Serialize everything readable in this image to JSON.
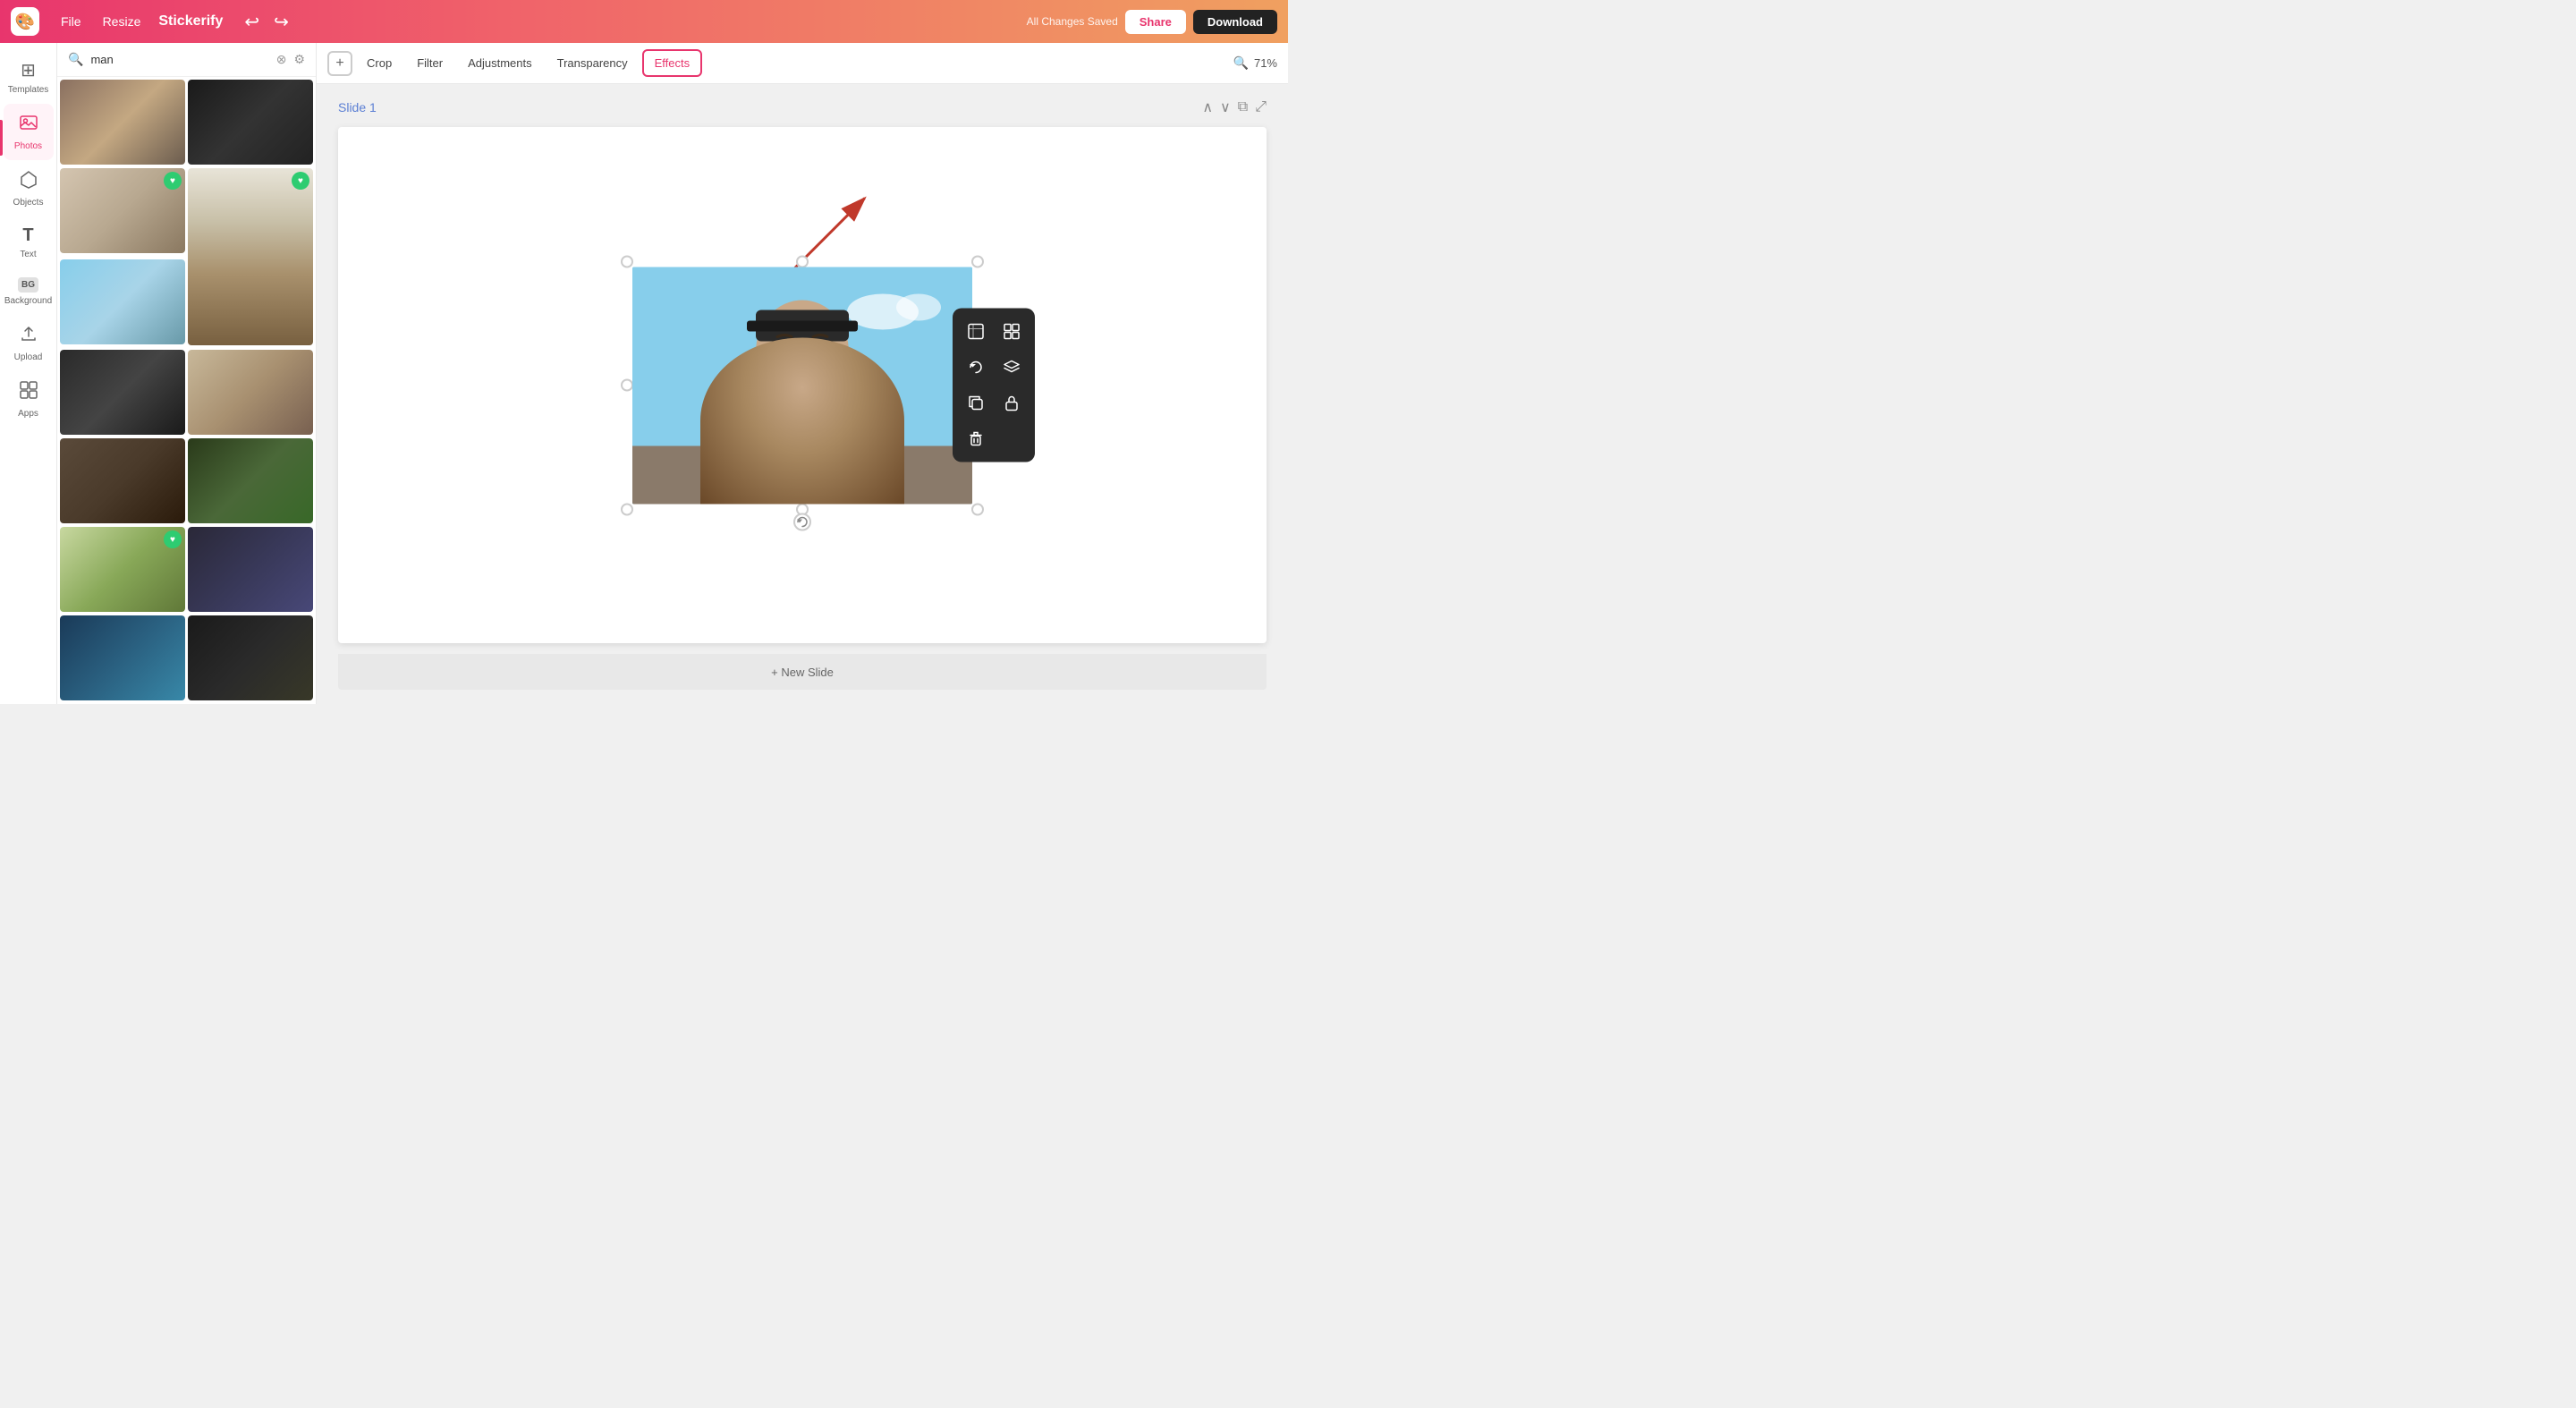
{
  "topbar": {
    "logo_icon": "🎨",
    "file_label": "File",
    "resize_label": "Resize",
    "app_name": "Stickerify",
    "saved_text": "All Changes Saved",
    "share_label": "Share",
    "download_label": "Download"
  },
  "sidebar": {
    "items": [
      {
        "id": "templates",
        "label": "Templates",
        "icon": "⊞"
      },
      {
        "id": "photos",
        "label": "Photos",
        "icon": "🖼",
        "active": true
      },
      {
        "id": "objects",
        "label": "Objects",
        "icon": "☕"
      },
      {
        "id": "text",
        "label": "Text",
        "icon": "T"
      },
      {
        "id": "background",
        "label": "Background",
        "icon": "BG"
      },
      {
        "id": "upload",
        "label": "Upload",
        "icon": "↑"
      },
      {
        "id": "apps",
        "label": "Apps",
        "icon": "⊞"
      }
    ]
  },
  "search": {
    "placeholder": "man",
    "value": "man"
  },
  "toolbar": {
    "add_icon": "+",
    "tabs": [
      {
        "id": "crop",
        "label": "Crop"
      },
      {
        "id": "filter",
        "label": "Filter"
      },
      {
        "id": "adjustments",
        "label": "Adjustments"
      },
      {
        "id": "transparency",
        "label": "Transparency"
      },
      {
        "id": "effects",
        "label": "Effects",
        "active": true
      }
    ],
    "zoom_icon": "🔍",
    "zoom_level": "71%"
  },
  "canvas": {
    "slide_title": "Slide 1",
    "new_slide_label": "+ New Slide"
  },
  "floating_toolbar": {
    "buttons": [
      {
        "id": "resize",
        "icon": "⤢"
      },
      {
        "id": "split",
        "icon": "⋮⋮"
      },
      {
        "id": "refresh",
        "icon": "⟳"
      },
      {
        "id": "layers",
        "icon": "▤"
      },
      {
        "id": "copy",
        "icon": "⧉"
      },
      {
        "id": "lock",
        "icon": "🔓"
      },
      {
        "id": "delete",
        "icon": "🗑"
      }
    ]
  }
}
